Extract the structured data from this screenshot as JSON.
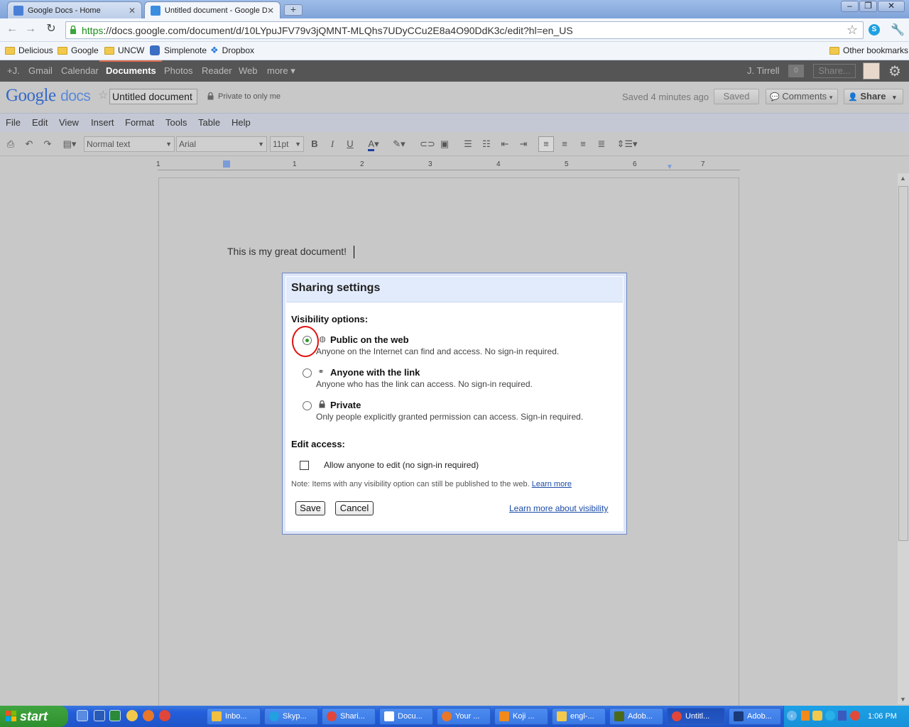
{
  "browser": {
    "tabs": [
      {
        "label": "Google Docs - Home",
        "active": false
      },
      {
        "label": "Untitled document - Google Do",
        "active": true
      }
    ],
    "url_scheme": "https",
    "url_rest": "://docs.google.com/document/d/10LYpuJFV79v3jQMNT-MLQhs7UDyCCu2E8a4O90DdK3c/edit?hl=en_US",
    "bookmarks": [
      "Delicious",
      "Google",
      "UNCW",
      "Simplenote",
      "Dropbox"
    ],
    "other_bookmarks": "Other bookmarks"
  },
  "gbar": {
    "items": [
      "+J.",
      "Gmail",
      "Calendar",
      "Documents",
      "Photos",
      "Reader",
      "Web",
      "more ▾"
    ],
    "user": "J. Tirrell",
    "count": "0",
    "share": "Share..."
  },
  "docs": {
    "logo_google": "Google",
    "logo_docs": "docs",
    "title": "Untitled document",
    "privacy": "Private to only me",
    "saved_status": "Saved 4 minutes ago",
    "saved_button": "Saved",
    "comments_button": "Comments",
    "share_button": "Share"
  },
  "menu": [
    "File",
    "Edit",
    "View",
    "Insert",
    "Format",
    "Tools",
    "Table",
    "Help"
  ],
  "toolbar": {
    "style": "Normal text",
    "font": "Arial",
    "size": "11pt"
  },
  "ruler_numbers": [
    "1",
    "1",
    "2",
    "3",
    "4",
    "5",
    "6",
    "7"
  ],
  "document": {
    "text": "This is my great document!"
  },
  "dialog": {
    "title": "Sharing settings",
    "visibility_label": "Visibility options:",
    "options": [
      {
        "title": "Public on the web",
        "desc": "Anyone on the Internet can find and access. No sign-in required.",
        "selected": true
      },
      {
        "title": "Anyone with the link",
        "desc": "Anyone who has the link can access. No sign-in required.",
        "selected": false
      },
      {
        "title": "Private",
        "desc": "Only people explicitly granted permission can access. Sign-in required.",
        "selected": false
      }
    ],
    "edit_label": "Edit access:",
    "edit_checkbox": "Allow anyone to edit (no sign-in required)",
    "note": "Note: Items with any visibility option can still be published to the web.",
    "note_link": "Learn more",
    "save": "Save",
    "cancel": "Cancel",
    "visibility_link": "Learn more about visibility"
  },
  "taskbar": {
    "start": "start",
    "tasks": [
      "Inbo...",
      "Skyp...",
      "Shari...",
      "Docu...",
      "Your ...",
      "Koji ...",
      "engl-...",
      "Adob...",
      "Untitl...",
      "Adob..."
    ],
    "clock": "1:06 PM"
  },
  "colors": {
    "accent_blue": "#1a4aa6",
    "highlight_circle": "#e01010",
    "radio_selected": "#2a9c2a"
  }
}
